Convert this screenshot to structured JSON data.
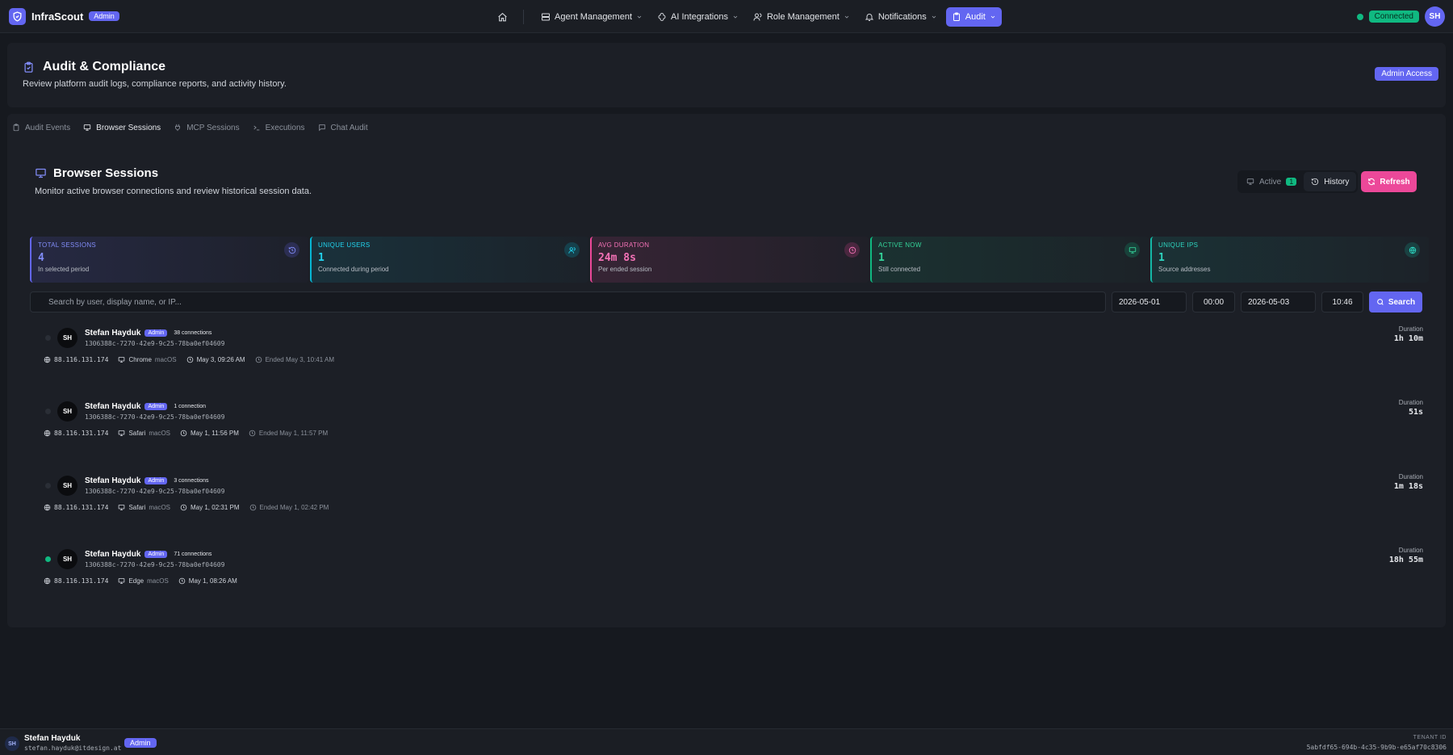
{
  "app": {
    "brand": "InfraScout",
    "brand_badge": "Admin",
    "status": "Connected",
    "user_initials": "SH"
  },
  "nav": {
    "items": [
      {
        "label": "Agent Management",
        "icon": "server-icon"
      },
      {
        "label": "AI Integrations",
        "icon": "ai-icon"
      },
      {
        "label": "Role Management",
        "icon": "users-icon"
      },
      {
        "label": "Notifications",
        "icon": "bell-icon"
      },
      {
        "label": "Audit",
        "icon": "clipboard-icon"
      }
    ]
  },
  "header": {
    "title": "Audit & Compliance",
    "subtitle": "Review platform audit logs, compliance reports, and activity history.",
    "badge": "Admin Access"
  },
  "tabs": [
    {
      "label": "Audit Events"
    },
    {
      "label": "Browser Sessions"
    },
    {
      "label": "MCP Sessions"
    },
    {
      "label": "Executions"
    },
    {
      "label": "Chat Audit"
    }
  ],
  "section": {
    "title": "Browser Sessions",
    "subtitle": "Monitor active browser connections and review historical session data.",
    "toggle_active": "Active",
    "toggle_active_count": "1",
    "toggle_history": "History",
    "refresh": "Refresh"
  },
  "stats": [
    {
      "label": "TOTAL SESSIONS",
      "value": "4",
      "sub": "In selected period",
      "color": "#6366f1"
    },
    {
      "label": "UNIQUE USERS",
      "value": "1",
      "sub": "Connected during period",
      "color": "#06b6d4"
    },
    {
      "label": "AVG DURATION",
      "value": "24m 8s",
      "sub": "Per ended session",
      "color": "#ec4899"
    },
    {
      "label": "ACTIVE NOW",
      "value": "1",
      "sub": "Still connected",
      "color": "#10b981"
    },
    {
      "label": "UNIQUE IPS",
      "value": "1",
      "sub": "Source addresses",
      "color": "#14b8a6"
    }
  ],
  "filters": {
    "search_placeholder": "Search by user, display name, or IP...",
    "from_date": "2026-05-01",
    "from_time": "00:00",
    "to_date": "2026-05-03",
    "to_time": "10:46",
    "search_button": "Search"
  },
  "sessions": [
    {
      "initials": "SH",
      "name": "Stefan Hayduk",
      "role": "Admin",
      "connections": "38 connections",
      "id": "1306388c-7270-42e9-9c25-78ba0ef04609",
      "ip": "88.116.131.174",
      "browser": "Chrome",
      "os": "macOS",
      "start": "May 3, 09:26 AM",
      "end": "Ended May 3, 10:41 AM",
      "duration_label": "Duration",
      "duration": "1h 10m",
      "live": false
    },
    {
      "initials": "SH",
      "name": "Stefan Hayduk",
      "role": "Admin",
      "connections": "1 connection",
      "id": "1306388c-7270-42e9-9c25-78ba0ef04609",
      "ip": "88.116.131.174",
      "browser": "Safari",
      "os": "macOS",
      "start": "May 1, 11:56 PM",
      "end": "Ended May 1, 11:57 PM",
      "duration_label": "Duration",
      "duration": "51s",
      "live": false
    },
    {
      "initials": "SH",
      "name": "Stefan Hayduk",
      "role": "Admin",
      "connections": "3 connections",
      "id": "1306388c-7270-42e9-9c25-78ba0ef04609",
      "ip": "88.116.131.174",
      "browser": "Safari",
      "os": "macOS",
      "start": "May 1, 02:31 PM",
      "end": "Ended May 1, 02:42 PM",
      "duration_label": "Duration",
      "duration": "1m 18s",
      "live": false
    },
    {
      "initials": "SH",
      "name": "Stefan Hayduk",
      "role": "Admin",
      "connections": "71 connections",
      "id": "1306388c-7270-42e9-9c25-78ba0ef04609",
      "ip": "88.116.131.174",
      "browser": "Edge",
      "os": "macOS",
      "start": "May 1, 08:26 AM",
      "end": "",
      "duration_label": "Duration",
      "duration": "18h 55m",
      "live": true
    }
  ],
  "footer": {
    "initials": "SH",
    "name": "Stefan Hayduk",
    "email": "stefan.hayduk@itdesign.at",
    "role": "Admin",
    "tenant_label": "TENANT ID",
    "tenant_id": "5abfdf65-694b-4c35-9b9b-e65af70c8306"
  }
}
